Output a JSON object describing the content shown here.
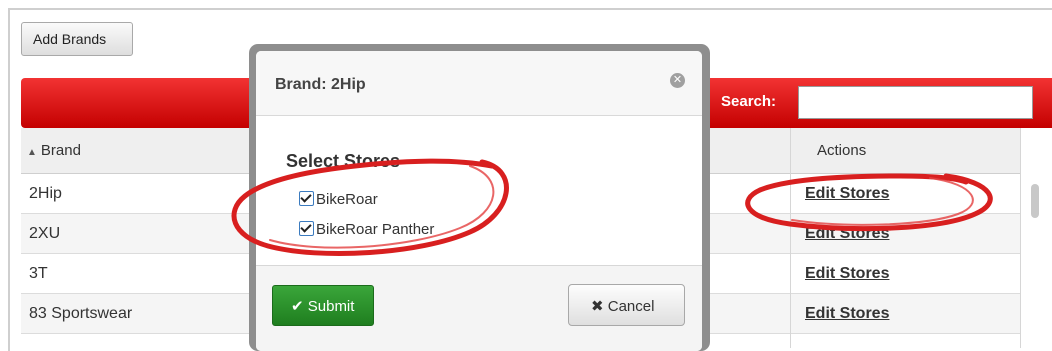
{
  "toolbar": {
    "add_brands_label": "Add Brands"
  },
  "search": {
    "label": "Search:",
    "value": ""
  },
  "table": {
    "columns": {
      "brand": "Brand",
      "actions": "Actions"
    },
    "sort_indicator": "▲",
    "rows": [
      {
        "brand": "2Hip",
        "action": "Edit Stores"
      },
      {
        "brand": "2XU",
        "action": "Edit Stores"
      },
      {
        "brand": "3T",
        "action": "Edit Stores"
      },
      {
        "brand": "83 Sportswear",
        "action": "Edit Stores"
      }
    ]
  },
  "modal": {
    "title": "Brand: 2Hip",
    "close_glyph": "✕",
    "section_title": "Select Stores",
    "stores": [
      {
        "label": "BikeRoar",
        "checked": true
      },
      {
        "label": "BikeRoar Panther",
        "checked": true
      }
    ],
    "submit_label": "Submit",
    "submit_glyph": "✔",
    "cancel_label": "Cancel",
    "cancel_glyph": "✖"
  },
  "colors": {
    "header_bar": "#d90000",
    "submit": "#2e8b2e",
    "annotation": "#d81f1f"
  },
  "icons": [
    "close-icon",
    "check-icon",
    "x-icon",
    "sort-up-icon"
  ]
}
